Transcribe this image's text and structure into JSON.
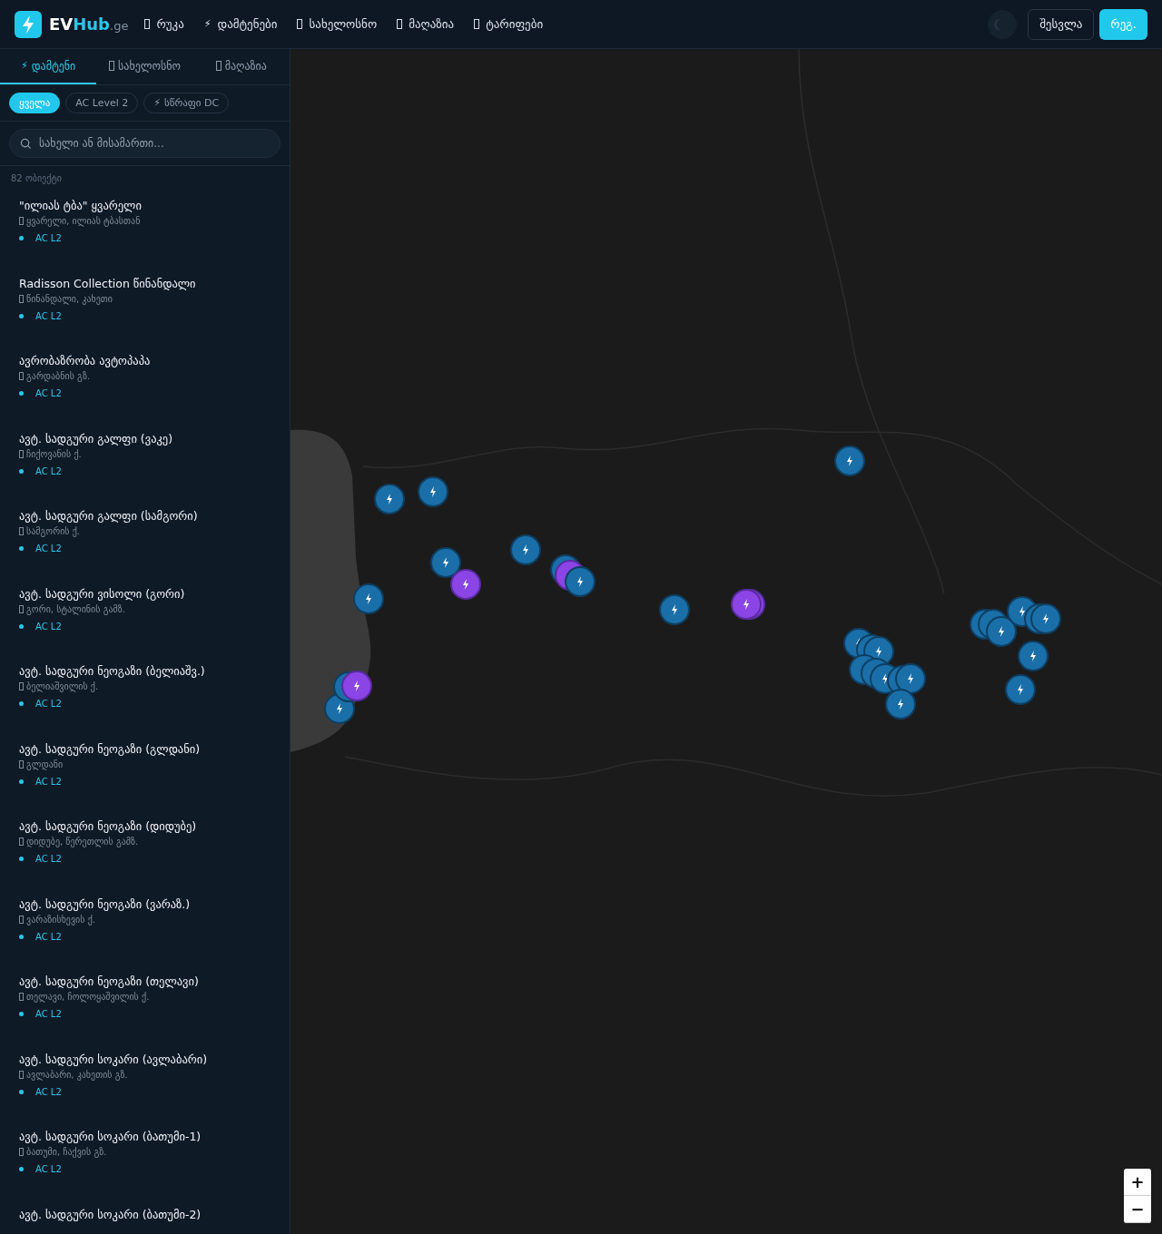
{
  "header": {
    "brand": {
      "first": "EV",
      "second": "Hub",
      "suffix": ".ge"
    },
    "nav": [
      {
        "label": "რუკა"
      },
      {
        "label": "დამტენები",
        "icon": "⚡"
      },
      {
        "label": "სახელოსნო"
      },
      {
        "label": "მაღაზია"
      },
      {
        "label": "ტარიფები"
      }
    ],
    "login": "შესვლა",
    "register": "რეგ."
  },
  "sidebar": {
    "tabs": [
      {
        "label": "დამტენი",
        "icon": "⚡",
        "selected": true
      },
      {
        "label": "სახელოსნო",
        "selected": false
      },
      {
        "label": "მაღაზია",
        "selected": false
      }
    ],
    "filters": [
      {
        "label": "ყველა",
        "selected": true
      },
      {
        "label": "AC Level 2",
        "selected": false
      },
      {
        "label": "სწრაფი DC",
        "icon": "⚡",
        "selected": false
      }
    ],
    "search": {
      "placeholder": "სახელი ან მისამართი..."
    },
    "count": "82 ობიექტი",
    "items": [
      {
        "name": "\"ილიას ტბა\" ყვარელი",
        "address": "ყვარელი, ილიას ტბასთან",
        "type": "AC L2"
      },
      {
        "name": "Radisson Collection წინანდალი",
        "address": "წინანდალი, კახეთი",
        "type": "AC L2"
      },
      {
        "name": "ავრობაზრობა ავტოპაპა",
        "address": "გარდაბნის გზ.",
        "type": "AC L2"
      },
      {
        "name": "ავტ. სადგური გალფი (ვაკე)",
        "address": "ჩიქოვანის ქ.",
        "type": "AC L2"
      },
      {
        "name": "ავტ. სადგური გალფი (სამგორი)",
        "address": "სამგორის ქ.",
        "type": "AC L2"
      },
      {
        "name": "ავტ. სადგური ვისოლი (გორი)",
        "address": "გორი, სტალინის გამზ.",
        "type": "AC L2"
      },
      {
        "name": "ავტ. სადგური ნეოგაზი (ბელიაშვ.)",
        "address": "ბელიაშვილის ქ.",
        "type": "AC L2"
      },
      {
        "name": "ავტ. სადგური ნეოგაზი (გლდანი)",
        "address": "გლდანი",
        "type": "AC L2"
      },
      {
        "name": "ავტ. სადგური ნეოგაზი (დიდუბე)",
        "address": "დიდუბე, წერეთლის გამზ.",
        "type": "AC L2"
      },
      {
        "name": "ავტ. სადგური ნეოგაზი (ვარაზ.)",
        "address": "ვარაზისხევის ქ.",
        "type": "AC L2"
      },
      {
        "name": "ავტ. სადგური ნეოგაზი (თელავი)",
        "address": "თელავი, ჩოლოყაშვილის ქ.",
        "type": "AC L2"
      },
      {
        "name": "ავტ. სადგური სოკარი (ავლაბარი)",
        "address": "ავლაბარი, კახეთის გზ.",
        "type": "AC L2"
      },
      {
        "name": "ავტ. სადგური სოკარი (ბათუმი-1)",
        "address": "ბათუმი, ჩაქვის გზ.",
        "type": "AC L2"
      },
      {
        "name": "ავტ. სადგური სოკარი (ბათუმი-2)"
      }
    ]
  },
  "map": {
    "zoom_in": "+",
    "zoom_out": "−"
  }
}
